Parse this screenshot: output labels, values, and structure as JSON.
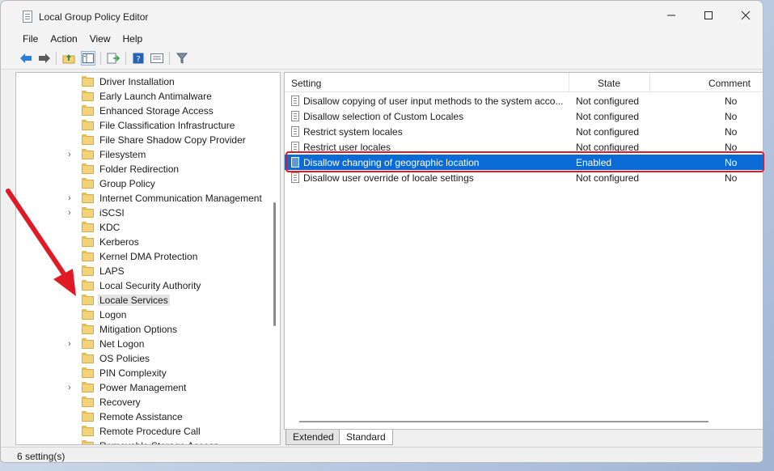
{
  "window": {
    "title": "Local Group Policy Editor"
  },
  "menu": [
    "File",
    "Action",
    "View",
    "Help"
  ],
  "toolbar": [
    "back-icon",
    "forward-icon",
    "up-folder-icon",
    "show-hide-tree-icon",
    "export-list-icon",
    "help-icon",
    "properties-icon",
    "filter-icon"
  ],
  "tree": {
    "items": [
      {
        "label": "Driver Installation",
        "expandable": false
      },
      {
        "label": "Early Launch Antimalware",
        "expandable": false
      },
      {
        "label": "Enhanced Storage Access",
        "expandable": false
      },
      {
        "label": "File Classification Infrastructure",
        "expandable": false
      },
      {
        "label": "File Share Shadow Copy Provider",
        "expandable": false
      },
      {
        "label": "Filesystem",
        "expandable": true
      },
      {
        "label": "Folder Redirection",
        "expandable": false
      },
      {
        "label": "Group Policy",
        "expandable": false
      },
      {
        "label": "Internet Communication Management",
        "expandable": true
      },
      {
        "label": "iSCSI",
        "expandable": true
      },
      {
        "label": "KDC",
        "expandable": false
      },
      {
        "label": "Kerberos",
        "expandable": false
      },
      {
        "label": "Kernel DMA Protection",
        "expandable": false
      },
      {
        "label": "LAPS",
        "expandable": false
      },
      {
        "label": "Local Security Authority",
        "expandable": false
      },
      {
        "label": "Locale Services",
        "expandable": false,
        "selected": true
      },
      {
        "label": "Logon",
        "expandable": false
      },
      {
        "label": "Mitigation Options",
        "expandable": false
      },
      {
        "label": "Net Logon",
        "expandable": true
      },
      {
        "label": "OS Policies",
        "expandable": false
      },
      {
        "label": "PIN Complexity",
        "expandable": false
      },
      {
        "label": "Power Management",
        "expandable": true
      },
      {
        "label": "Recovery",
        "expandable": false
      },
      {
        "label": "Remote Assistance",
        "expandable": false
      },
      {
        "label": "Remote Procedure Call",
        "expandable": false
      },
      {
        "label": "Removable Storage Access",
        "expandable": false
      }
    ]
  },
  "list": {
    "columns": {
      "setting": "Setting",
      "state": "State",
      "comment": "Comment"
    },
    "rows": [
      {
        "setting": "Disallow copying of user input methods to the system acco...",
        "state": "Not configured",
        "comment": "No"
      },
      {
        "setting": "Disallow selection of Custom Locales",
        "state": "Not configured",
        "comment": "No"
      },
      {
        "setting": "Restrict system locales",
        "state": "Not configured",
        "comment": "No"
      },
      {
        "setting": "Restrict user locales",
        "state": "Not configured",
        "comment": "No"
      },
      {
        "setting": "Disallow changing of geographic location",
        "state": "Enabled",
        "comment": "No",
        "highlight": true
      },
      {
        "setting": "Disallow user override of locale settings",
        "state": "Not configured",
        "comment": "No"
      }
    ]
  },
  "tabs": {
    "extended": "Extended",
    "standard": "Standard"
  },
  "status": {
    "text": "6 setting(s)"
  },
  "colors": {
    "selection": "#0a6bd6",
    "annotation": "#e01a25"
  }
}
